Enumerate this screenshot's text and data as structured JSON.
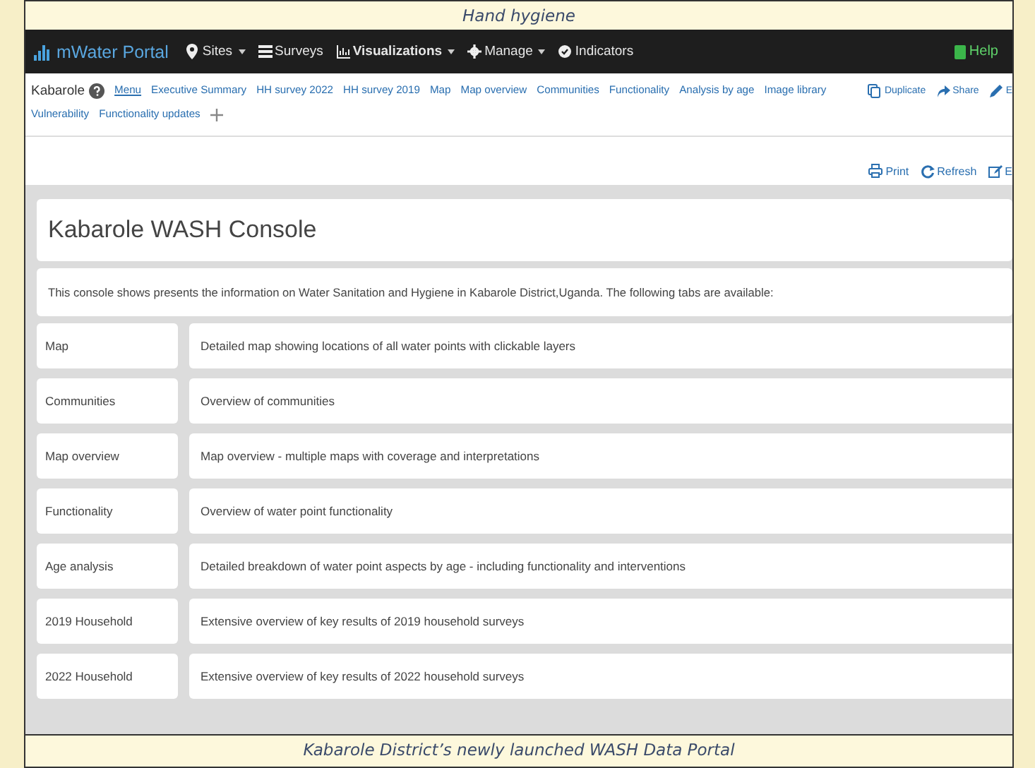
{
  "captions": {
    "top": "Hand hygiene",
    "bottom": "Kabarole District’s newly launched WASH Data Portal"
  },
  "navbar": {
    "brand": "mWater Portal",
    "items": [
      {
        "label": "Sites",
        "dropdown": true,
        "bold": false
      },
      {
        "label": "Surveys",
        "dropdown": false,
        "bold": false
      },
      {
        "label": "Visualizations",
        "dropdown": true,
        "bold": true
      },
      {
        "label": "Manage",
        "dropdown": true,
        "bold": false
      },
      {
        "label": "Indicators",
        "dropdown": false,
        "bold": false
      }
    ],
    "help": "Help"
  },
  "tabs": {
    "site": "Kabarole",
    "items": [
      {
        "label": "Menu",
        "selected": true
      },
      {
        "label": "Executive Summary",
        "selected": false
      },
      {
        "label": "HH survey 2022",
        "selected": false
      },
      {
        "label": "HH survey 2019",
        "selected": false
      },
      {
        "label": "Map",
        "selected": false
      },
      {
        "label": "Map overview",
        "selected": false
      },
      {
        "label": "Communities",
        "selected": false
      },
      {
        "label": "Functionality",
        "selected": false
      },
      {
        "label": "Analysis by age",
        "selected": false
      },
      {
        "label": "Image library",
        "selected": false
      },
      {
        "label": "Vulnerability",
        "selected": false
      },
      {
        "label": "Functionality updates",
        "selected": false
      }
    ],
    "actions": [
      {
        "label": "Duplicate"
      },
      {
        "label": "Share"
      },
      {
        "label": "E"
      }
    ]
  },
  "toolbar": [
    {
      "label": "Print"
    },
    {
      "label": "Refresh"
    },
    {
      "label": "E"
    }
  ],
  "console": {
    "title": "Kabarole WASH Console",
    "intro": "This console shows presents the information on Water Sanitation and Hygiene in Kabarole District,Uganda. The following tabs are available:",
    "rows": [
      {
        "tab": "Map",
        "description": "Detailed map showing locations of all water points with clickable layers"
      },
      {
        "tab": "Communities",
        "description": "Overview of communities"
      },
      {
        "tab": "Map overview",
        "description": "Map overview - multiple maps with coverage and interpretations"
      },
      {
        "tab": "Functionality",
        "description": "Overview of water point functionality"
      },
      {
        "tab": "Age analysis",
        "description": "Detailed breakdown of water point aspects by age - including functionality and interventions"
      },
      {
        "tab": "2019 Household",
        "description": "Extensive overview of key results of 2019 household surveys"
      },
      {
        "tab": "2022 Household",
        "description": "Extensive overview of key results of 2022 household surveys"
      }
    ]
  }
}
